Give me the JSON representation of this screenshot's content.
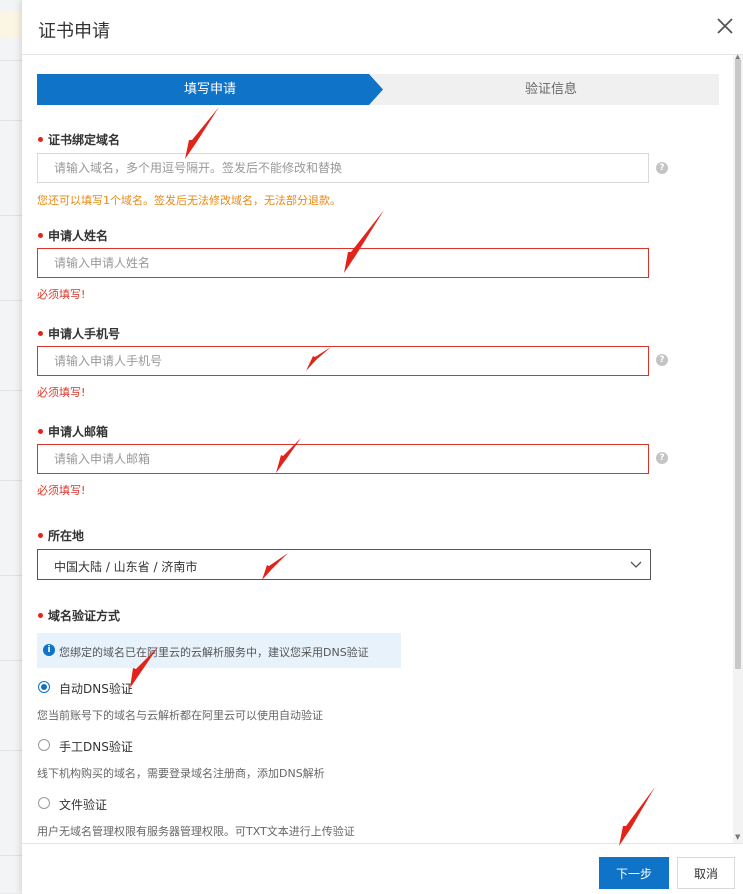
{
  "dialog": {
    "title": "证书申请",
    "close_icon": "close-icon"
  },
  "steps": [
    {
      "label": "填写申请",
      "active": true
    },
    {
      "label": "验证信息",
      "active": false
    }
  ],
  "form": {
    "domain": {
      "label": "证书绑定域名",
      "placeholder": "请输入域名，多个用逗号隔开。签发后不能修改和替换",
      "value": "",
      "hint": "您还可以填写1个域名。签发后无法修改域名，无法部分退款。"
    },
    "name": {
      "label": "申请人姓名",
      "placeholder": "请输入申请人姓名",
      "value": "",
      "error": "必须填写!"
    },
    "phone": {
      "label": "申请人手机号",
      "placeholder": "请输入申请人手机号",
      "value": "",
      "error": "必须填写!"
    },
    "email": {
      "label": "申请人邮箱",
      "placeholder": "请输入申请人邮箱",
      "value": "",
      "error": "必须填写!"
    },
    "location": {
      "label": "所在地",
      "value": "中国大陆 / 山东省 / 济南市"
    },
    "verification": {
      "label": "域名验证方式",
      "info": "您绑定的域名已在阿里云的云解析服务中，建议您采用DNS验证",
      "options": [
        {
          "label": "自动DNS验证",
          "selected": true,
          "desc": "您当前账号下的域名与云解析都在阿里云可以使用自动验证"
        },
        {
          "label": "手工DNS验证",
          "selected": false,
          "desc": "线下机构购买的域名，需要登录域名注册商，添加DNS解析"
        },
        {
          "label": "文件验证",
          "selected": false,
          "desc": "用户无域名管理权限有服务器管理权限。可TXT文本进行上传验证"
        }
      ]
    }
  },
  "footer": {
    "next_label": "下一步",
    "cancel_label": "取消"
  },
  "colors": {
    "primary": "#0f73c7",
    "error": "#d9352a",
    "warning": "#e58a16",
    "annotation_arrow": "#e2231a"
  }
}
